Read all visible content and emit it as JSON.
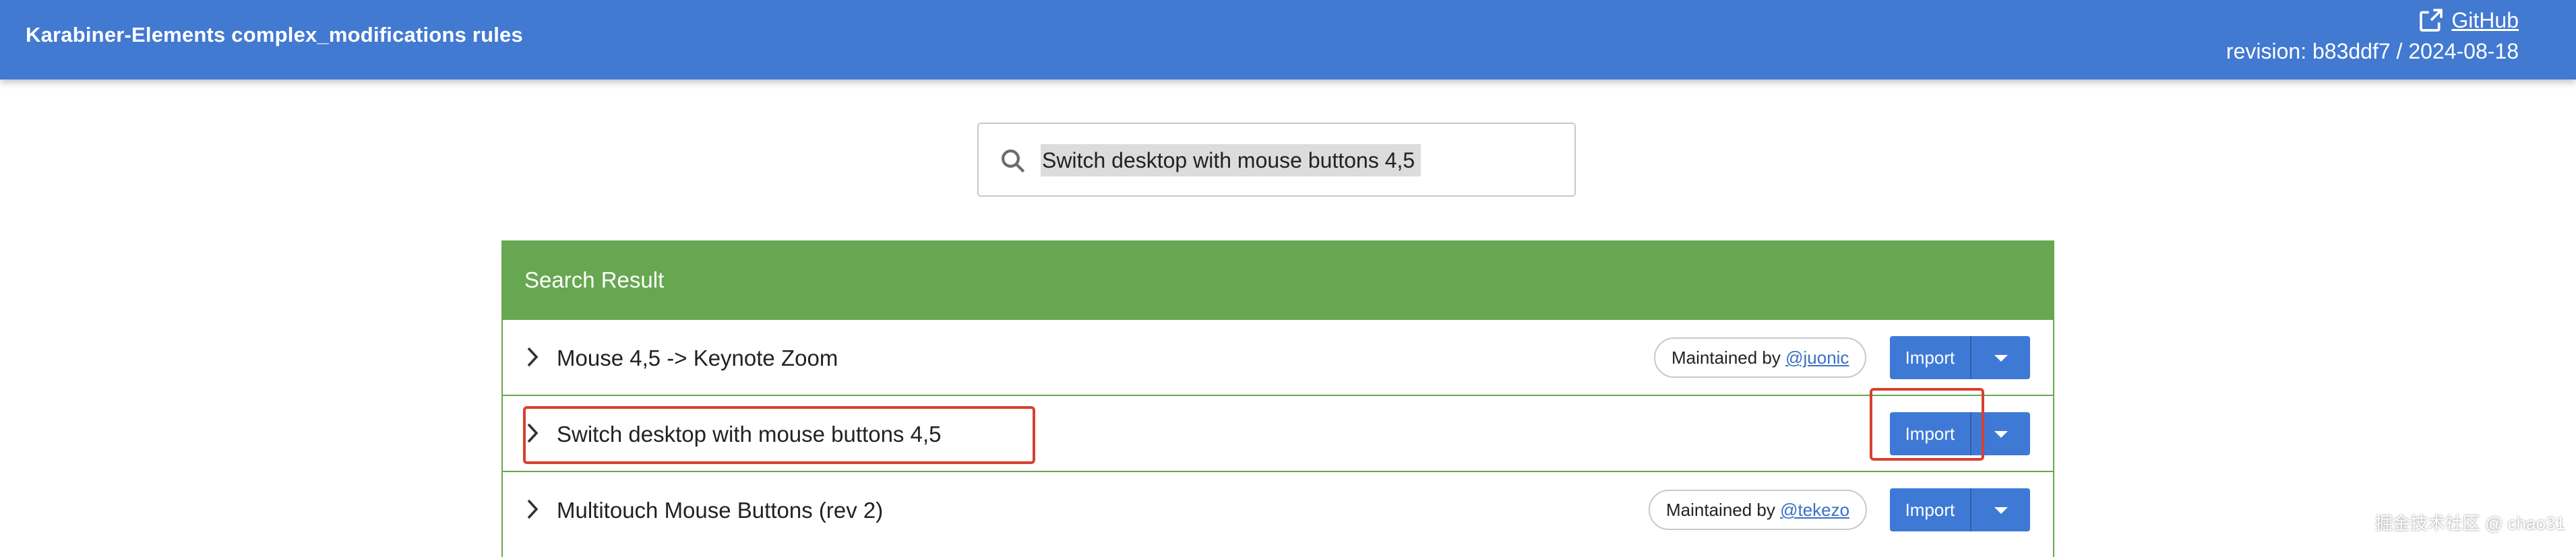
{
  "header": {
    "title": "Karabiner-Elements complex_modifications rules",
    "github_label": "GitHub",
    "revision": "revision: b83ddf7 / 2024-08-18"
  },
  "search": {
    "value": "Switch desktop with mouse buttons 4,5",
    "icon": "search-icon"
  },
  "results": {
    "heading": "Search Result",
    "rows": [
      {
        "label": "Mouse 4,5 -> Keynote Zoom",
        "maintained_prefix": "Maintained by ",
        "maintainer": "@juonic",
        "import_label": "Import"
      },
      {
        "label": "Switch desktop with mouse buttons 4,5",
        "import_label": "Import"
      },
      {
        "label": "Multitouch Mouse Buttons (rev 2)",
        "maintained_prefix": "Maintained by ",
        "maintainer": "@tekezo",
        "import_label": "Import"
      }
    ]
  },
  "watermark": "掘金技术社区 @ chao31",
  "colors": {
    "header": "#4279d1",
    "result_header": "#67a751",
    "import_button": "#3e79d6",
    "highlight": "#d7402f"
  }
}
